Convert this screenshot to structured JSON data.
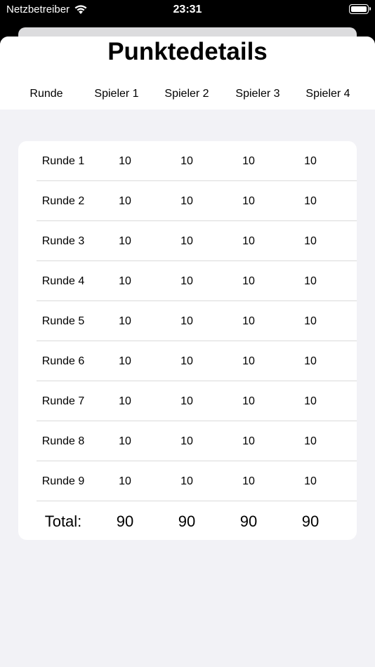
{
  "status_bar": {
    "carrier": "Netzbetreiber",
    "time": "23:31",
    "wifi_icon": "wifi-icon",
    "battery_icon": "battery-icon"
  },
  "header": {
    "title": "Punktedetails",
    "columns": [
      "Runde",
      "Spieler 1",
      "Spieler 2",
      "Spieler 3",
      "Spieler 4"
    ]
  },
  "rows": [
    {
      "label": "Runde 1",
      "scores": [
        "10",
        "10",
        "10",
        "10"
      ]
    },
    {
      "label": "Runde 2",
      "scores": [
        "10",
        "10",
        "10",
        "10"
      ]
    },
    {
      "label": "Runde 3",
      "scores": [
        "10",
        "10",
        "10",
        "10"
      ]
    },
    {
      "label": "Runde 4",
      "scores": [
        "10",
        "10",
        "10",
        "10"
      ]
    },
    {
      "label": "Runde 5",
      "scores": [
        "10",
        "10",
        "10",
        "10"
      ]
    },
    {
      "label": "Runde 6",
      "scores": [
        "10",
        "10",
        "10",
        "10"
      ]
    },
    {
      "label": "Runde 7",
      "scores": [
        "10",
        "10",
        "10",
        "10"
      ]
    },
    {
      "label": "Runde 8",
      "scores": [
        "10",
        "10",
        "10",
        "10"
      ]
    },
    {
      "label": "Runde 9",
      "scores": [
        "10",
        "10",
        "10",
        "10"
      ]
    }
  ],
  "total": {
    "label": "Total:",
    "scores": [
      "90",
      "90",
      "90",
      "90"
    ]
  },
  "colors": {
    "background": "#f2f2f6",
    "card": "#ffffff",
    "separator": "#dadada"
  }
}
